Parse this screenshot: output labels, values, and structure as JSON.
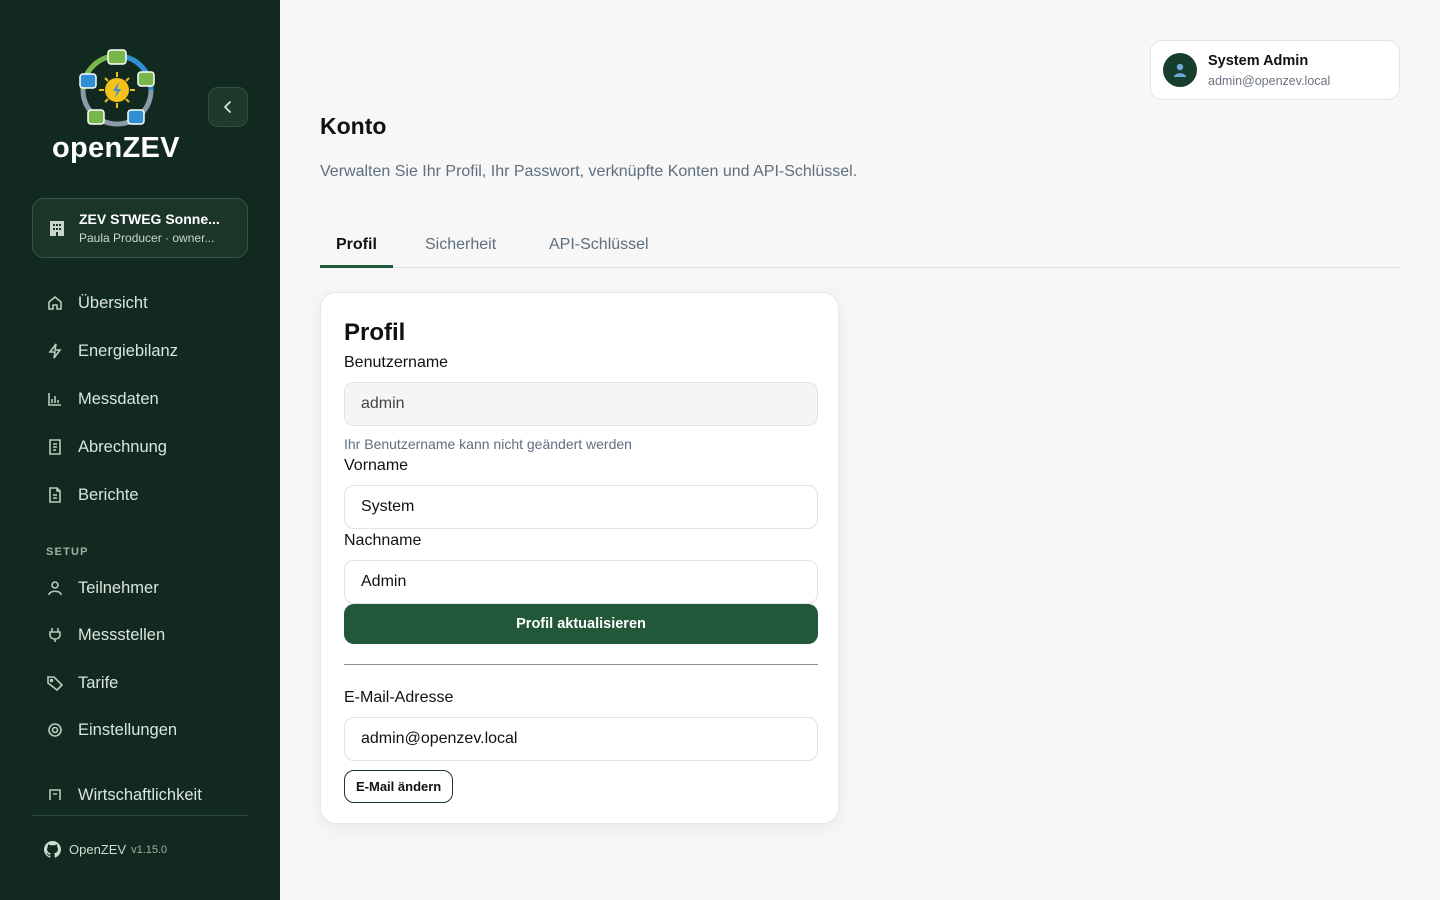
{
  "app": {
    "name": "openZEV"
  },
  "sidebar": {
    "org": {
      "name": "ZEV STWEG Sonne...",
      "subtitle": "Paula Producer · owner..."
    },
    "items": [
      {
        "label": "Übersicht",
        "icon": "home-icon"
      },
      {
        "label": "Energiebilanz",
        "icon": "lightning-icon"
      },
      {
        "label": "Messdaten",
        "icon": "bar-chart-icon"
      },
      {
        "label": "Abrechnung",
        "icon": "receipt-icon"
      },
      {
        "label": "Berichte",
        "icon": "document-icon"
      }
    ],
    "setup_label": "SETUP",
    "setup_items": [
      {
        "label": "Teilnehmer",
        "icon": "user-icon"
      },
      {
        "label": "Messstellen",
        "icon": "plug-icon"
      },
      {
        "label": "Tarife",
        "icon": "tag-icon"
      },
      {
        "label": "Einstellungen",
        "icon": "gear-icon"
      },
      {
        "label": "Wirtschaftlichkeit",
        "icon": "calculator-icon"
      }
    ],
    "footer": {
      "name": "OpenZEV",
      "version": "v1.15.0"
    }
  },
  "user": {
    "name": "System Admin",
    "email": "admin@openzev.local"
  },
  "page": {
    "title": "Konto",
    "description": "Verwalten Sie Ihr Profil, Ihr Passwort, verknüpfte Konten und API-Schlüssel."
  },
  "tabs": [
    {
      "label": "Profil",
      "active": true
    },
    {
      "label": "Sicherheit",
      "active": false
    },
    {
      "label": "API-Schlüssel",
      "active": false
    }
  ],
  "profile": {
    "title": "Profil",
    "username_label": "Benutzername",
    "username_value": "admin",
    "username_help": "Ihr Benutzername kann nicht geändert werden",
    "firstname_label": "Vorname",
    "firstname_value": "System",
    "lastname_label": "Nachname",
    "lastname_value": "Admin",
    "update_button": "Profil aktualisieren",
    "email_label": "E-Mail-Adresse",
    "email_value": "admin@openzev.local",
    "email_button": "E-Mail ändern"
  },
  "colors": {
    "sidebar_bg": "#12291f",
    "primary": "#22573a",
    "page_bg": "#f6f7f6"
  }
}
